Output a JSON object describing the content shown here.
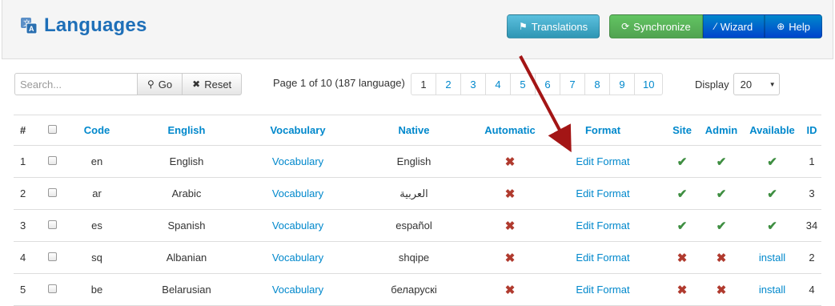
{
  "header": {
    "title": "Languages",
    "buttons": {
      "translations": "Translations",
      "synchronize": "Synchronize",
      "wizard": "Wizard",
      "help": "Help"
    }
  },
  "filter": {
    "search_placeholder": "Search...",
    "go_label": "Go",
    "reset_label": "Reset"
  },
  "pagination": {
    "info": "Page 1 of 10 (187 language)",
    "pages": [
      "1",
      "2",
      "3",
      "4",
      "5",
      "6",
      "7",
      "8",
      "9",
      "10"
    ]
  },
  "display": {
    "label": "Display",
    "value": "20"
  },
  "table": {
    "headers": [
      "#",
      "",
      "Code",
      "English",
      "Vocabulary",
      "Native",
      "Automatic",
      "Format",
      "Site",
      "Admin",
      "Available",
      "ID"
    ],
    "rows": [
      {
        "num": "1",
        "code": "en",
        "english": "English",
        "vocab": "Vocabulary",
        "native": "English",
        "format": "Edit Format",
        "available": "",
        "id": "1"
      },
      {
        "num": "2",
        "code": "ar",
        "english": "Arabic",
        "vocab": "Vocabulary",
        "native": "العربية",
        "format": "Edit Format",
        "available": "",
        "id": "3"
      },
      {
        "num": "3",
        "code": "es",
        "english": "Spanish",
        "vocab": "Vocabulary",
        "native": "español",
        "format": "Edit Format",
        "available": "",
        "id": "34"
      },
      {
        "num": "4",
        "code": "sq",
        "english": "Albanian",
        "vocab": "Vocabulary",
        "native": "shqipe",
        "format": "Edit Format",
        "available": "install",
        "id": "2"
      },
      {
        "num": "5",
        "code": "be",
        "english": "Belarusian",
        "vocab": "Vocabulary",
        "native": "беларускі",
        "format": "Edit Format",
        "available": "install",
        "id": "4"
      }
    ]
  },
  "icons": {
    "check": "check-icon",
    "cross": "cross-icon"
  },
  "colors": {
    "accent": "#0088cc",
    "title": "#1e6fb8",
    "check": "#3e8e41",
    "cross": "#b03a2e",
    "arrow": "#a31515"
  }
}
